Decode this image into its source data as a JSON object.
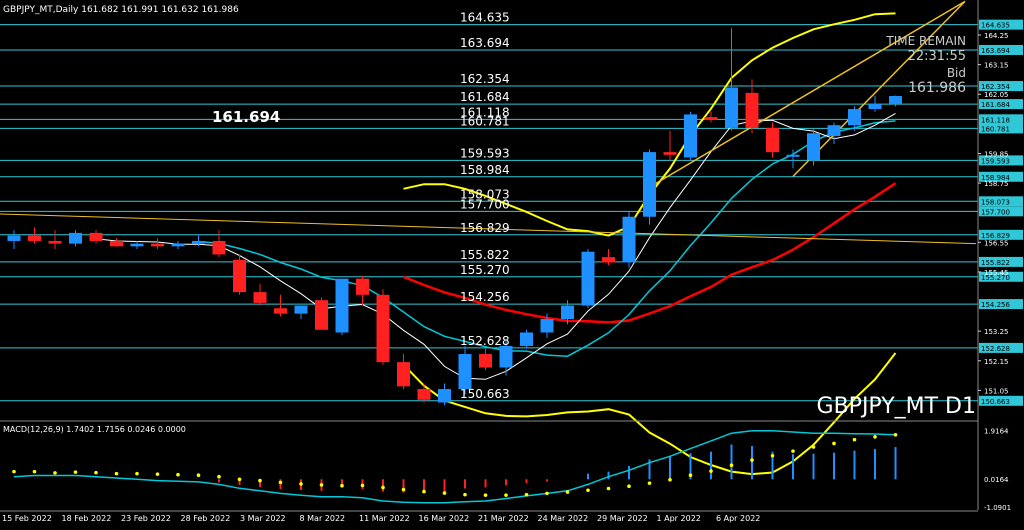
{
  "header": {
    "symbol_line": "GBPJPY_MT,Daily  161.682 161.991 161.632 161.986",
    "macd_line": "MACD(12,26,9) 1.7402 1.7156 0.0246 0.0000"
  },
  "overlay": {
    "time_remain_label": "TIME REMAIN",
    "time_remain_value": "22:31:55",
    "bid_label": "Bid",
    "bid_value": "161.986",
    "big_label": "161.694",
    "watermark": "GBPJPY_MT D1"
  },
  "colors": {
    "background": "#000000",
    "bull": "#1e90ff",
    "bear": "#ff2020",
    "levels": "#30c8d8",
    "bollinger": "#ffff00",
    "ma_red": "#ff0000",
    "ma_cyan": "#00c8d8",
    "ma_white": "#ffffff",
    "channel": "#f0c020"
  },
  "chart_data": {
    "type": "candlestick",
    "symbol": "GBPJPY_MT",
    "timeframe": "Daily",
    "ylim": [
      149.95,
      165.55
    ],
    "x_tick_labels": [
      "15 Feb 2022",
      "18 Feb 2022",
      "23 Feb 2022",
      "28 Feb 2022",
      "3 Mar 2022",
      "8 Mar 2022",
      "11 Mar 2022",
      "16 Mar 2022",
      "21 Mar 2022",
      "24 Mar 2022",
      "29 Mar 2022",
      "1 Apr 2022",
      "6 Apr 2022"
    ],
    "y_tick_labels": [
      164.25,
      163.15,
      162.05,
      159.85,
      158.75,
      156.55,
      155.45,
      153.25,
      152.15,
      151.05
    ],
    "horizontal_levels": [
      164.635,
      163.694,
      162.354,
      161.684,
      161.118,
      160.781,
      159.593,
      158.984,
      158.073,
      157.7,
      156.829,
      155.822,
      155.27,
      154.256,
      152.628,
      150.663
    ],
    "candles": [
      {
        "o": 156.6,
        "h": 157.0,
        "l": 156.3,
        "c": 156.8
      },
      {
        "o": 156.8,
        "h": 157.1,
        "l": 156.5,
        "c": 156.6
      },
      {
        "o": 156.6,
        "h": 157.0,
        "l": 156.3,
        "c": 156.5
      },
      {
        "o": 156.5,
        "h": 157.0,
        "l": 156.4,
        "c": 156.9
      },
      {
        "o": 156.9,
        "h": 157.0,
        "l": 156.5,
        "c": 156.6
      },
      {
        "o": 156.6,
        "h": 156.7,
        "l": 156.4,
        "c": 156.4
      },
      {
        "o": 156.4,
        "h": 156.6,
        "l": 156.3,
        "c": 156.5
      },
      {
        "o": 156.5,
        "h": 156.7,
        "l": 156.3,
        "c": 156.4
      },
      {
        "o": 156.4,
        "h": 156.6,
        "l": 156.3,
        "c": 156.5
      },
      {
        "o": 156.5,
        "h": 156.8,
        "l": 156.4,
        "c": 156.6
      },
      {
        "o": 156.6,
        "h": 157.0,
        "l": 156.0,
        "c": 156.1
      },
      {
        "o": 155.9,
        "h": 156.1,
        "l": 154.6,
        "c": 154.7
      },
      {
        "o": 154.7,
        "h": 155.0,
        "l": 154.2,
        "c": 154.3
      },
      {
        "o": 154.1,
        "h": 154.6,
        "l": 153.8,
        "c": 153.9
      },
      {
        "o": 153.9,
        "h": 154.2,
        "l": 153.7,
        "c": 154.2
      },
      {
        "o": 154.4,
        "h": 154.5,
        "l": 153.3,
        "c": 153.3
      },
      {
        "o": 153.2,
        "h": 155.2,
        "l": 153.1,
        "c": 155.2
      },
      {
        "o": 155.2,
        "h": 155.3,
        "l": 154.2,
        "c": 154.6
      },
      {
        "o": 154.6,
        "h": 154.8,
        "l": 152.0,
        "c": 152.1
      },
      {
        "o": 152.1,
        "h": 152.4,
        "l": 151.1,
        "c": 151.2
      },
      {
        "o": 151.1,
        "h": 151.3,
        "l": 150.6,
        "c": 150.7
      },
      {
        "o": 150.6,
        "h": 151.3,
        "l": 150.5,
        "c": 151.1
      },
      {
        "o": 151.1,
        "h": 152.7,
        "l": 150.9,
        "c": 152.4
      },
      {
        "o": 152.4,
        "h": 152.6,
        "l": 151.8,
        "c": 151.9
      },
      {
        "o": 151.9,
        "h": 152.9,
        "l": 151.6,
        "c": 152.7
      },
      {
        "o": 152.7,
        "h": 153.3,
        "l": 152.6,
        "c": 153.2
      },
      {
        "o": 153.2,
        "h": 153.9,
        "l": 153.0,
        "c": 153.7
      },
      {
        "o": 153.7,
        "h": 154.4,
        "l": 153.5,
        "c": 154.2
      },
      {
        "o": 154.2,
        "h": 156.3,
        "l": 154.1,
        "c": 156.2
      },
      {
        "o": 156.0,
        "h": 156.3,
        "l": 155.7,
        "c": 155.8
      },
      {
        "o": 155.8,
        "h": 157.7,
        "l": 155.6,
        "c": 157.5
      },
      {
        "o": 157.5,
        "h": 160.0,
        "l": 157.2,
        "c": 159.9
      },
      {
        "o": 159.9,
        "h": 160.7,
        "l": 159.6,
        "c": 159.8
      },
      {
        "o": 159.7,
        "h": 161.4,
        "l": 159.6,
        "c": 161.3
      },
      {
        "o": 161.2,
        "h": 161.4,
        "l": 161.0,
        "c": 161.1
      },
      {
        "o": 160.8,
        "h": 164.5,
        "l": 160.7,
        "c": 162.3
      },
      {
        "o": 162.1,
        "h": 162.6,
        "l": 160.6,
        "c": 160.8
      },
      {
        "o": 160.8,
        "h": 161.0,
        "l": 159.7,
        "c": 159.9
      },
      {
        "o": 159.8,
        "h": 160.0,
        "l": 159.3,
        "c": 159.8
      },
      {
        "o": 159.6,
        "h": 160.8,
        "l": 159.4,
        "c": 160.6
      },
      {
        "o": 160.5,
        "h": 161.0,
        "l": 160.2,
        "c": 160.9
      },
      {
        "o": 160.9,
        "h": 161.6,
        "l": 160.7,
        "c": 161.5
      },
      {
        "o": 161.5,
        "h": 162.0,
        "l": 161.4,
        "c": 161.7
      },
      {
        "o": 161.7,
        "h": 162.0,
        "l": 161.6,
        "c": 161.986
      }
    ],
    "macd": {
      "ylim": [
        -1.2,
        2.2
      ],
      "y_tick_labels": [
        1.9164,
        0.0164,
        -1.0901
      ],
      "histogram": [
        0.0,
        0.0,
        0.0,
        0.0,
        0.0,
        0.0,
        0.0,
        0.0,
        0.0,
        0.0,
        -0.12,
        -0.22,
        -0.3,
        -0.38,
        -0.42,
        -0.45,
        -0.32,
        -0.38,
        -0.48,
        -0.52,
        -0.55,
        -0.5,
        -0.36,
        -0.32,
        -0.24,
        -0.16,
        -0.08,
        0.0,
        0.22,
        0.3,
        0.52,
        0.78,
        0.88,
        1.02,
        1.08,
        1.36,
        1.3,
        1.08,
        0.98,
        1.0,
        1.04,
        1.12,
        1.18,
        1.26
      ],
      "signal": [
        0.3,
        0.3,
        0.25,
        0.28,
        0.26,
        0.22,
        0.22,
        0.2,
        0.18,
        0.16,
        0.1,
        0.0,
        -0.05,
        -0.12,
        -0.18,
        -0.22,
        -0.25,
        -0.24,
        -0.32,
        -0.4,
        -0.48,
        -0.54,
        -0.6,
        -0.62,
        -0.62,
        -0.6,
        -0.55,
        -0.5,
        -0.43,
        -0.36,
        -0.27,
        -0.15,
        -0.02,
        0.16,
        0.32,
        0.55,
        0.75,
        0.92,
        1.1,
        1.26,
        1.4,
        1.55,
        1.66,
        1.74
      ],
      "main": [
        0.1,
        0.15,
        0.15,
        0.15,
        0.1,
        0.05,
        0.0,
        -0.05,
        -0.08,
        -0.1,
        -0.2,
        -0.35,
        -0.45,
        -0.55,
        -0.62,
        -0.68,
        -0.68,
        -0.72,
        -0.85,
        -0.9,
        -0.92,
        -0.92,
        -0.88,
        -0.85,
        -0.75,
        -0.65,
        -0.55,
        -0.45,
        -0.2,
        0.1,
        0.35,
        0.65,
        0.9,
        1.2,
        1.5,
        1.8,
        1.9,
        1.9,
        1.85,
        1.8,
        1.8,
        1.78,
        1.77,
        1.74
      ]
    }
  }
}
